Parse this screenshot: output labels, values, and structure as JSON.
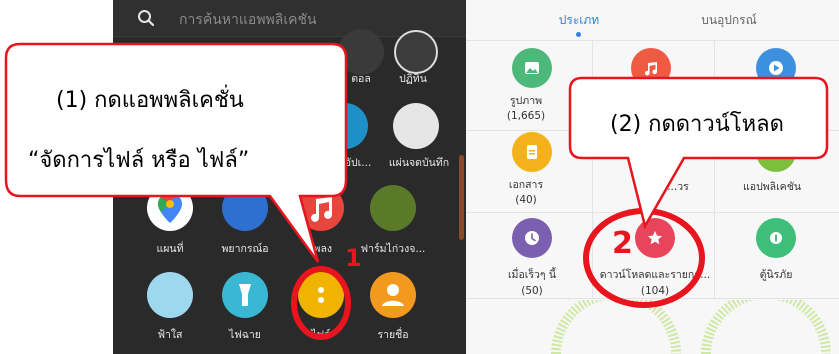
{
  "search": {
    "placeholder": "การค้นหาแอพพลิเคชัน"
  },
  "drawer_apps": [
    {
      "label": "ตอล",
      "color": "#3a3a3a"
    },
    {
      "label": "ปฏิทิน",
      "color": "#3a3a3a"
    },
    {
      "label": "อัปเ...",
      "color": "#1e90c8"
    },
    {
      "label": "แผ่นจดบันทึก",
      "color": "#e6e6e6"
    },
    {
      "label": "แผนที่",
      "color": "#ffffff"
    },
    {
      "label": "พยากรณ์อ",
      "color": "#2f6fd0"
    },
    {
      "label": "เพลง",
      "color": "#e8453c"
    },
    {
      "label": "ฟาร์มไก่วงจ...",
      "color": "#5a7a2a"
    },
    {
      "label": "ฟ้าใส",
      "color": "#9ed8ef"
    },
    {
      "label": "ไฟฉาย",
      "color": "#3ab7d3"
    },
    {
      "label": "ไฟล์",
      "color": "#f0b400"
    },
    {
      "label": "รายชื่อ",
      "color": "#f39a1e"
    }
  ],
  "tabs": [
    {
      "label": "ประเภท",
      "active": true
    },
    {
      "label": "บนอุปกรณ์",
      "active": false
    }
  ],
  "categories": [
    {
      "label": "รูปภาพ",
      "count": "(1,665)",
      "color": "#4cb87a",
      "icon": "image-icon"
    },
    {
      "label": "",
      "count": "",
      "color": "#ef5a43",
      "icon": "music-icon"
    },
    {
      "label": "",
      "count": "",
      "color": "#3d8fe0",
      "icon": "video-icon"
    },
    {
      "label": "เอกสาร",
      "count": "(40)",
      "color": "#f3b21b",
      "icon": "document-icon"
    },
    {
      "label": "...วร",
      "count": "",
      "color": "#7cbf3f",
      "icon": "apk-icon"
    },
    {
      "label": "แอปพลิเคชัน",
      "count": "",
      "color": "#7cbf3f",
      "icon": "apps-icon"
    },
    {
      "label": "เมื่อเร็วๆ นี้",
      "count": "(50)",
      "color": "#7b5fb0",
      "icon": "clock-icon"
    },
    {
      "label": "ดาวน์โหลดและรายกา...",
      "count": "(104)",
      "color": "#e8455c",
      "icon": "star-icon"
    },
    {
      "label": "ตู้นิรภัย",
      "count": "",
      "color": "#3dbf7a",
      "icon": "safe-icon"
    }
  ],
  "callouts": [
    {
      "line1": "(1) กดแอพพลิเคชั่น",
      "line2": "“จัดการไฟล์ หรือ ไฟล์”"
    },
    {
      "line1": "(2) กดดาวน์โหลด"
    }
  ],
  "markers": {
    "step1": "1",
    "step2": "2"
  },
  "colors": {
    "highlight_red": "#e8141e",
    "accent_blue": "#2f82e0"
  }
}
